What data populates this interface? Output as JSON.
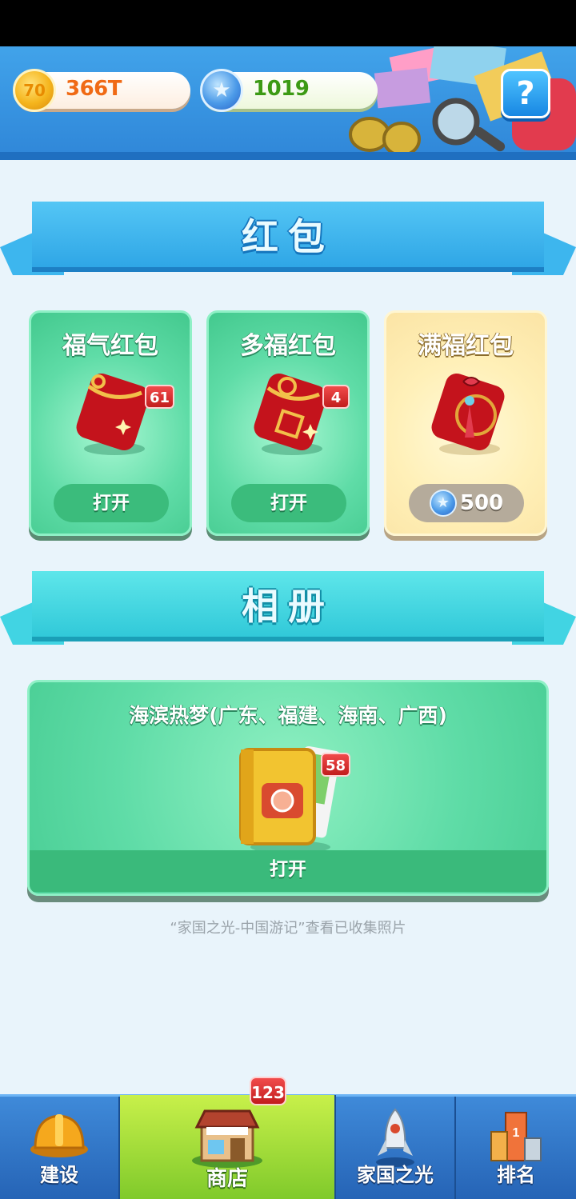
{
  "header": {
    "coins": "366T",
    "gems": "1019",
    "coin_icon_text": "70",
    "help": "?"
  },
  "sections": {
    "red_packets_title": "红包",
    "album_title": "相册"
  },
  "red_packets": [
    {
      "name": "福气红包",
      "count": "61",
      "action": "打开"
    },
    {
      "name": "多福红包",
      "count": "4",
      "action": "打开"
    },
    {
      "name": "满福红包",
      "price": "500"
    }
  ],
  "album": {
    "name": "海滨热梦(广东、福建、海南、广西)",
    "count": "58",
    "action": "打开",
    "hint": "“家国之光-中国游记”查看已收集照片"
  },
  "tabs": {
    "build": "建设",
    "shop": "商店",
    "shop_badge": "123",
    "home": "家国之光",
    "rank": "排名"
  },
  "colors": {
    "header_blue": "#2f86d8",
    "card_green": "#5fdca7",
    "card_gold": "#fff0b8",
    "badge_red": "#c21d1d",
    "shop_tab_green": "#7ec92a"
  },
  "icons": {
    "coin": "coin-icon",
    "gem": "star-gem-icon",
    "help": "help-icon",
    "build": "hardhat-icon",
    "shop": "shop-building-icon",
    "home": "rocket-icon",
    "rank": "podium-icon"
  }
}
